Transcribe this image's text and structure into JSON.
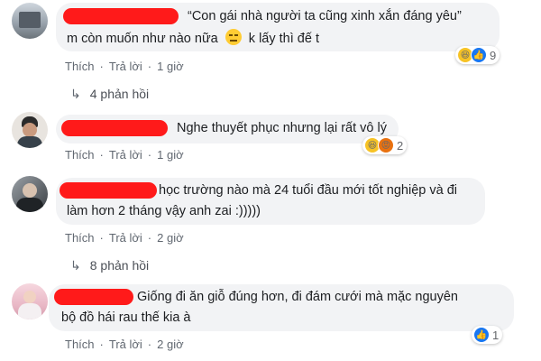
{
  "comments": [
    {
      "line1": "“Con gái nhà người ta cũng xinh xắn đáng yêu”",
      "line2_before": "m còn muốn như nào nữa",
      "line2_after": "k lấy thì đế t",
      "inline_emoji": "😑",
      "like": "Thích",
      "reply": "Trả lời",
      "time": "1 giờ",
      "reaction_count": "9",
      "replies_text": "4 phản hồi"
    },
    {
      "line1": "Nghe thuyết phục nhưng lại rất vô lý",
      "like": "Thích",
      "reply": "Trả lời",
      "time": "1 giờ",
      "reaction_count": "2"
    },
    {
      "line1": "học trường nào mà 24 tuổi đầu mới tốt nghiệp và đi",
      "line2": "làm hơn 2 tháng vậy anh zai :)))))",
      "like": "Thích",
      "reply": "Trả lời",
      "time": "2 giờ",
      "replies_text": "8 phản hồi"
    },
    {
      "line1": "Giống đi ăn giỗ đúng hơn, đi đám cưới mà mặc nguyên",
      "line2": "bộ đồ hái rau thế kia à",
      "like": "Thích",
      "reply": "Trả lời",
      "time": "2 giờ",
      "reaction_count": "1"
    }
  ],
  "icons": {
    "haha": "😆",
    "like": "👍",
    "angry": "😡"
  },
  "colors": {
    "bubble": "#f2f3f5",
    "redaction": "#ff1a1a",
    "meta_text": "#606770",
    "like_blue": "#1877f2"
  }
}
